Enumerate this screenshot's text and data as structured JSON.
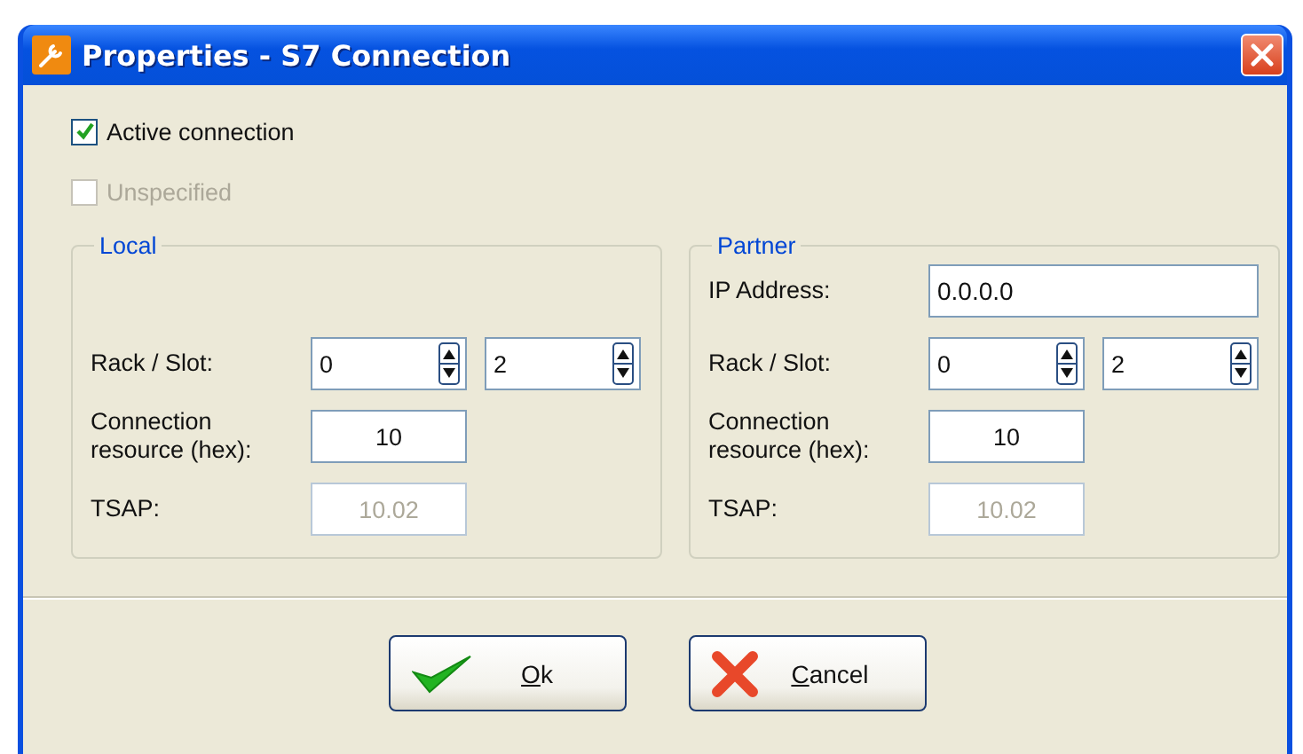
{
  "window": {
    "title": "Properties - S7 Connection"
  },
  "options": [
    {
      "label": "Active connection",
      "checked": true,
      "disabled": false
    },
    {
      "label": "Unspecified",
      "checked": false,
      "disabled": true
    }
  ],
  "groups": [
    {
      "title": "Local",
      "fields": [
        {
          "kind": "spin_pair",
          "label": "Rack / Slot:",
          "values": [
            "0",
            "2"
          ]
        },
        {
          "kind": "text",
          "label": "Connection resource (hex):",
          "value": "10",
          "disabled": false
        },
        {
          "kind": "text",
          "label": "TSAP:",
          "value": "10.02",
          "disabled": true
        }
      ]
    },
    {
      "title": "Partner",
      "fields": [
        {
          "kind": "wide",
          "label": "IP Address:",
          "value": "0.0.0.0"
        },
        {
          "kind": "spin_pair",
          "label": "Rack / Slot:",
          "values": [
            "0",
            "2"
          ]
        },
        {
          "kind": "text",
          "label": "Connection resource (hex):",
          "value": "10",
          "disabled": false
        },
        {
          "kind": "text",
          "label": "TSAP:",
          "value": "10.02",
          "disabled": true
        }
      ]
    }
  ],
  "buttons": [
    {
      "kind": "ok",
      "mnemonic": "O",
      "rest": "k"
    },
    {
      "kind": "cancel",
      "mnemonic": "C",
      "rest": "ancel"
    }
  ]
}
